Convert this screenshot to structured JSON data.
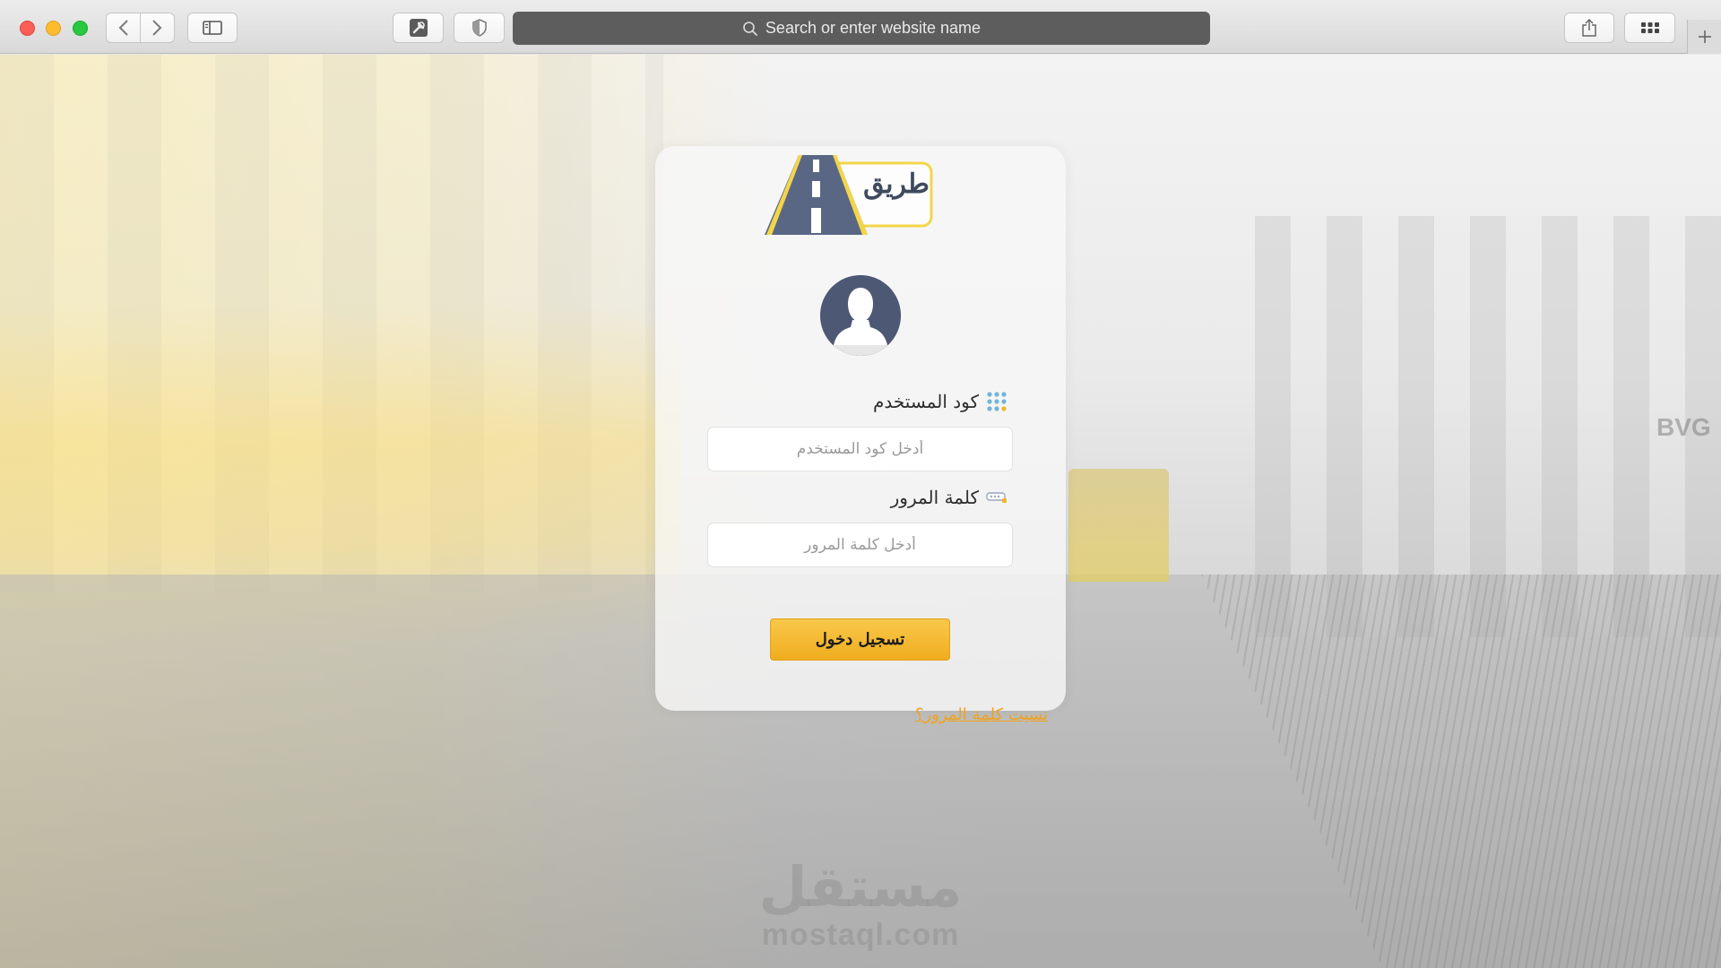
{
  "browser": {
    "address_placeholder": "Search or enter website name",
    "icons": {
      "back": "chevron-left-icon",
      "forward": "chevron-right-icon",
      "sidebar": "sidebar-icon",
      "tool": "tool-icon",
      "shield": "shield-icon",
      "search": "search-icon",
      "share": "share-icon",
      "tabs": "tab-overview-icon",
      "new_tab": "plus-icon"
    }
  },
  "login": {
    "logo_text": "طريق",
    "username_label": "كود المستخدم",
    "username_placeholder": "أدخل كود المستخدم",
    "password_label": "كلمة المرور",
    "password_placeholder": "أدخل كلمة المرور",
    "submit_label": "تسجيل دخول",
    "forgot_label": "نسيت كلمة المرور؟"
  },
  "background": {
    "sign_text": "BVG"
  },
  "watermark": {
    "arabic": "مستقل",
    "latin": "mostaql.com"
  },
  "colors": {
    "accent": "#f0ad1e",
    "logo_road": "#5a6784",
    "logo_border": "#f3d54a",
    "avatar_bg": "#4d5875"
  }
}
